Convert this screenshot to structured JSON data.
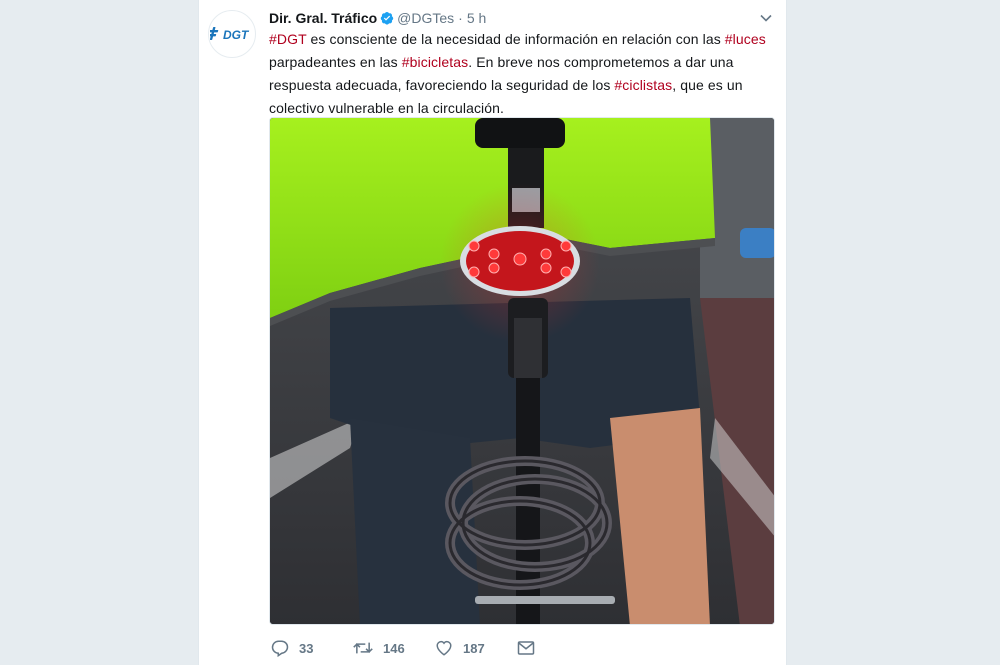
{
  "tweet": {
    "author": {
      "display_name": "Dir. Gral. Tráfico",
      "handle": "@DGTes",
      "separator": "·",
      "time": "5 h",
      "avatar_logo_text": "DGT",
      "verified_icon": "verified-badge-icon"
    },
    "text_segments": [
      {
        "type": "hashtag",
        "text": "#DGT"
      },
      {
        "type": "text",
        "text": " es consciente de la necesidad de información en relación con las "
      },
      {
        "type": "hashtag",
        "text": "#luces"
      },
      {
        "type": "text",
        "text": " parpadeantes en las  "
      },
      {
        "type": "hashtag",
        "text": "#bicicletas"
      },
      {
        "type": "text",
        "text": ". En breve nos comprometemos a dar una respuesta adecuada, favoreciendo la seguridad de los "
      },
      {
        "type": "hashtag",
        "text": "#ciclistas"
      },
      {
        "type": "text",
        "text": ", que es un colectivo vulnerable en la circulación."
      }
    ],
    "actions": {
      "reply": {
        "icon": "reply-icon",
        "count": "33"
      },
      "retweet": {
        "icon": "retweet-icon",
        "count": "146"
      },
      "like": {
        "icon": "heart-icon",
        "count": "187"
      },
      "message": {
        "icon": "envelope-icon"
      }
    }
  },
  "colors": {
    "hashtag": "#b0001e",
    "verified": "#1da1f2",
    "dgt_blue": "#1b75bb",
    "background": "#e6ecf0",
    "muted": "#657786"
  }
}
